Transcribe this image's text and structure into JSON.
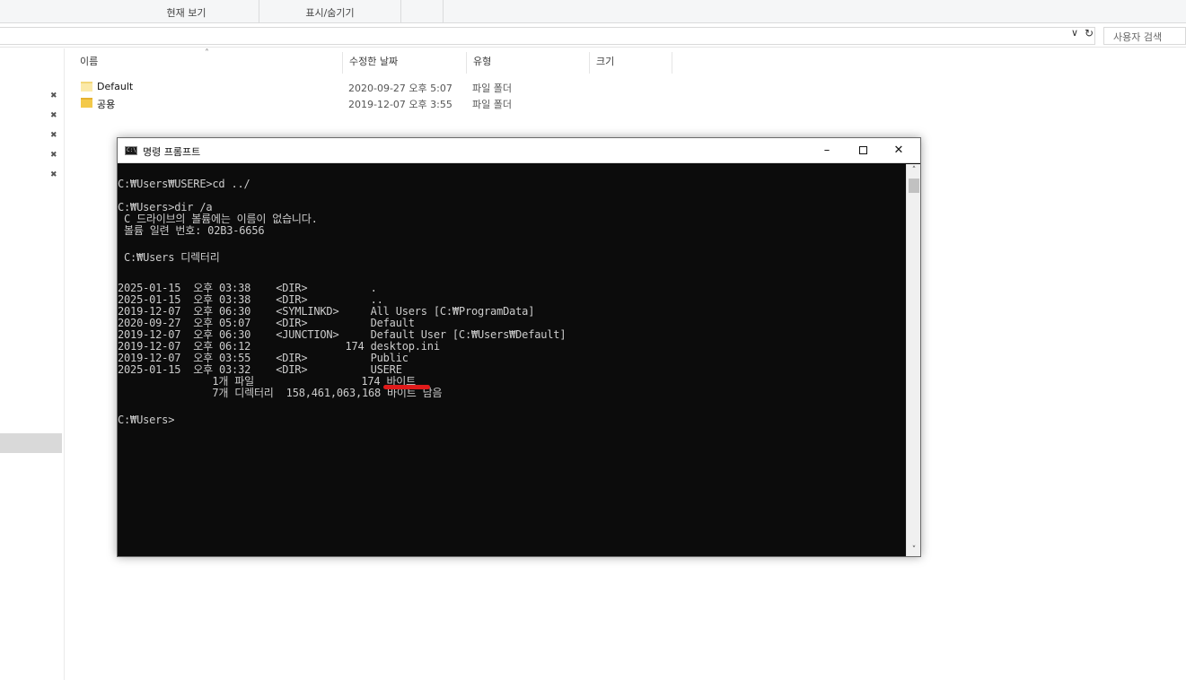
{
  "ribbon": {
    "groups": [
      {
        "label": "현재 보기"
      },
      {
        "label": "표시/숨기기"
      }
    ]
  },
  "address_bar": {
    "search_placeholder": "사용자 검색"
  },
  "file_list": {
    "columns": [
      "이름",
      "수정한 날짜",
      "유형",
      "크기"
    ],
    "rows": [
      {
        "name": "Default",
        "date": "2020-09-27 오후 5:07",
        "type": "파일 폴더"
      },
      {
        "name": "공용",
        "date": "2019-12-07 오후 3:55",
        "type": "파일 폴더"
      }
    ]
  },
  "cmd": {
    "title": "명령 프롬프트",
    "icon_text": "C:\\",
    "lines": [
      "C:₩Users₩USERE>cd ../",
      "",
      "C:₩Users>dir /a",
      " C 드라이브의 볼륨에는 이름이 없습니다.",
      " 볼륨 일련 번호: 02B3-6656",
      "",
      " C:₩Users 디렉터리",
      "",
      "2025-01-15  오후 03:38    <DIR>          .",
      "2025-01-15  오후 03:38    <DIR>          ..",
      "2019-12-07  오후 06:30    <SYMLINKD>     All Users [C:₩ProgramData]",
      "2020-09-27  오후 05:07    <DIR>          Default",
      "2019-12-07  오후 06:30    <JUNCTION>     Default User [C:₩Users₩Default]",
      "2019-12-07  오후 06:12               174 desktop.ini",
      "2019-12-07  오후 03:55    <DIR>          Public",
      "2025-01-15  오후 03:32    <DIR>          USERE",
      "               1개 파일                 174 바이트",
      "               7개 디렉터리  158,461,063,168 바이트 남음",
      "",
      "C:₩Users>"
    ]
  },
  "colors": {
    "console_bg": "#0c0c0c",
    "console_text": "#cccccc",
    "annotation_red": "#e01b1b",
    "folder_yellow": "#f3c94a"
  },
  "icons": {
    "pin": "pin-icon",
    "folder": "folder-icon",
    "refresh": "refresh-icon",
    "chevron": "chevron-down-icon"
  }
}
